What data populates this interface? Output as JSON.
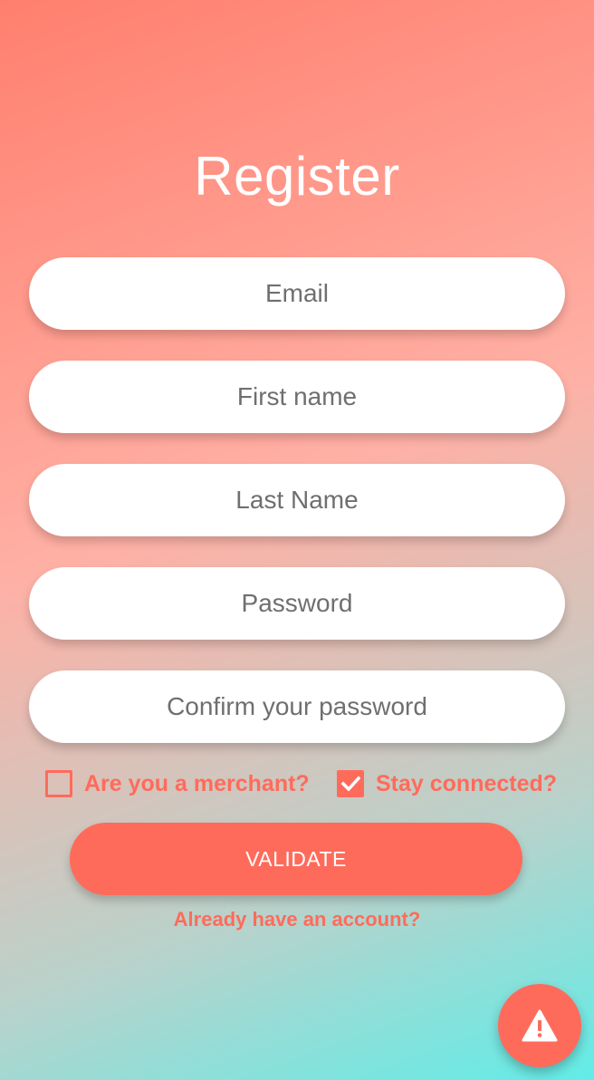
{
  "register": {
    "title": "Register",
    "fields": {
      "email": {
        "placeholder": "Email",
        "value": ""
      },
      "first_name": {
        "placeholder": "First name",
        "value": ""
      },
      "last_name": {
        "placeholder": "Last Name",
        "value": ""
      },
      "password": {
        "placeholder": "Password",
        "value": ""
      },
      "confirm_password": {
        "placeholder": "Confirm your password",
        "value": ""
      }
    },
    "checkboxes": {
      "merchant": {
        "label": "Are you a merchant?",
        "checked": false
      },
      "stay_connected": {
        "label": "Stay connected?",
        "checked": true
      }
    },
    "validate_label": "VALIDATE",
    "account_link": "Already have an account?"
  },
  "fab": {
    "icon": "warning-icon"
  },
  "colors": {
    "accent": "#ff6b5b",
    "gradient_top": "#ff7f6e",
    "gradient_bottom": "#62ece7",
    "field_bg": "#ffffff",
    "placeholder_text": "#6f6f6f"
  }
}
